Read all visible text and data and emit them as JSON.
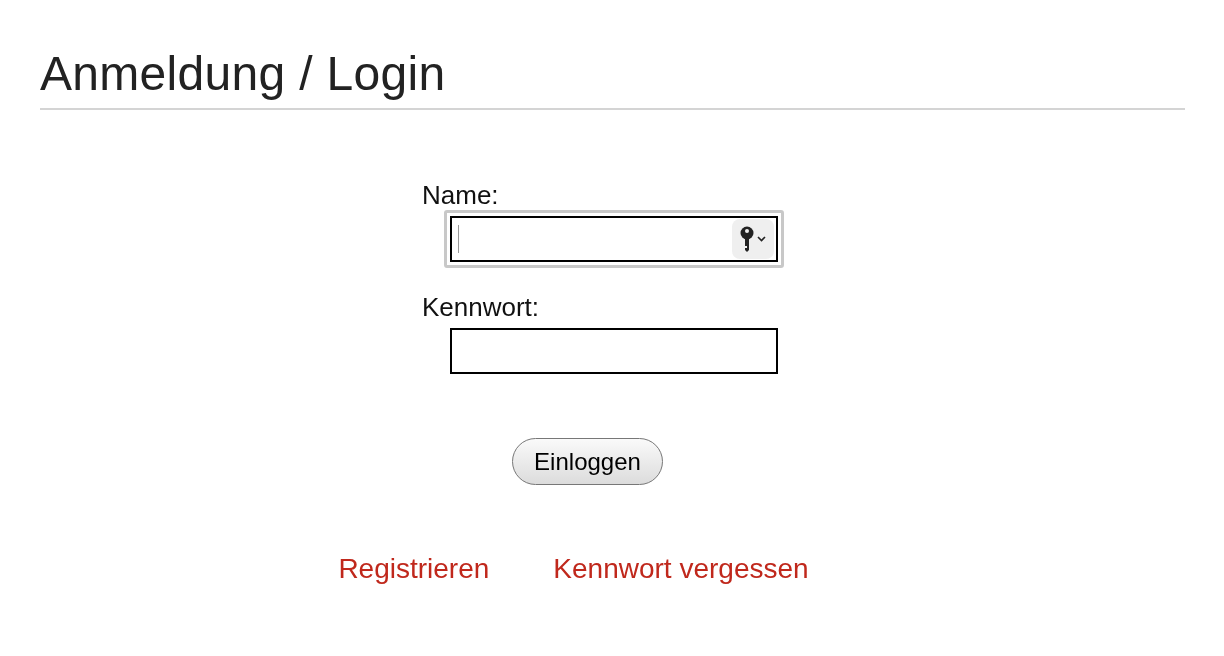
{
  "heading": "Anmeldung / Login",
  "fields": [
    {
      "label": "Name:",
      "focused": true,
      "password_key": true
    },
    {
      "label": "Kennwort:",
      "focused": false,
      "password_key": false
    }
  ],
  "button": "Einloggen",
  "links": [
    "Registrieren",
    "Kennwort vergessen"
  ]
}
